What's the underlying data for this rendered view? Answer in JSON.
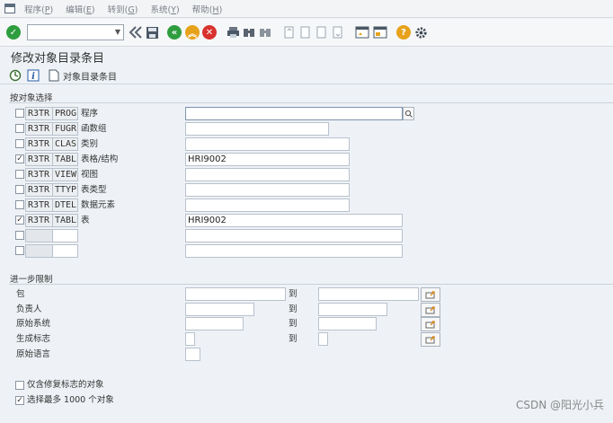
{
  "menubar": {
    "items": [
      "程序(P)",
      "编辑(E)",
      "转到(G)",
      "系统(Y)",
      "帮助(H)"
    ]
  },
  "toolbar": {
    "command_value": "",
    "icons": [
      "check-icon",
      "back-nav-icon",
      "save-icon",
      "back-icon",
      "exit-icon",
      "cancel-icon",
      "print-icon",
      "find-icon",
      "find-next-icon",
      "first-page-icon",
      "prev-page-icon",
      "next-page-icon",
      "last-page-icon",
      "new-session-icon",
      "shortcut-icon",
      "help-icon",
      "settings-icon"
    ]
  },
  "page": {
    "title": "修改对象目录条目"
  },
  "app_toolbar": {
    "entry_label": "对象目录条目"
  },
  "object_selection": {
    "title": "按对象选择",
    "rows": [
      {
        "checked": false,
        "pgmid": "R3TR",
        "type": "PROG",
        "desc": "程序",
        "value": ""
      },
      {
        "checked": false,
        "pgmid": "R3TR",
        "type": "FUGR",
        "desc": "函数组",
        "value": ""
      },
      {
        "checked": false,
        "pgmid": "R3TR",
        "type": "CLAS",
        "desc": "类别",
        "value": ""
      },
      {
        "checked": true,
        "pgmid": "R3TR",
        "type": "TABL",
        "desc": "表格/结构",
        "value": "HRI9002"
      },
      {
        "checked": false,
        "pgmid": "R3TR",
        "type": "VIEW",
        "desc": "视图",
        "value": ""
      },
      {
        "checked": false,
        "pgmid": "R3TR",
        "type": "TTYP",
        "desc": "表类型",
        "value": ""
      },
      {
        "checked": false,
        "pgmid": "R3TR",
        "type": "DTEL",
        "desc": "数据元素",
        "value": ""
      },
      {
        "checked": true,
        "pgmid": "R3TR",
        "type": "TABL",
        "desc": "表",
        "value": "HRI9002"
      },
      {
        "checked": false,
        "pgmid": "",
        "type": "",
        "desc": "",
        "value": ""
      },
      {
        "checked": false,
        "pgmid": "",
        "type": "",
        "desc": "",
        "value": ""
      }
    ]
  },
  "restrictions": {
    "title": "进一步限制",
    "to_label": "到",
    "rows": [
      {
        "label": "包",
        "from": "",
        "to": ""
      },
      {
        "label": "负责人",
        "from": "",
        "to": ""
      },
      {
        "label": "原始系统",
        "from": "",
        "to": ""
      },
      {
        "label": "生成标志",
        "from": "",
        "to": ""
      },
      {
        "label": "原始语言",
        "from": ""
      }
    ]
  },
  "options": {
    "only_repair": {
      "checked": false,
      "label": "仅含修复标志的对象"
    },
    "max_objects": {
      "checked": true,
      "label": "选择最多 1000 个对象"
    }
  },
  "watermark": "CSDN @阳光小兵"
}
